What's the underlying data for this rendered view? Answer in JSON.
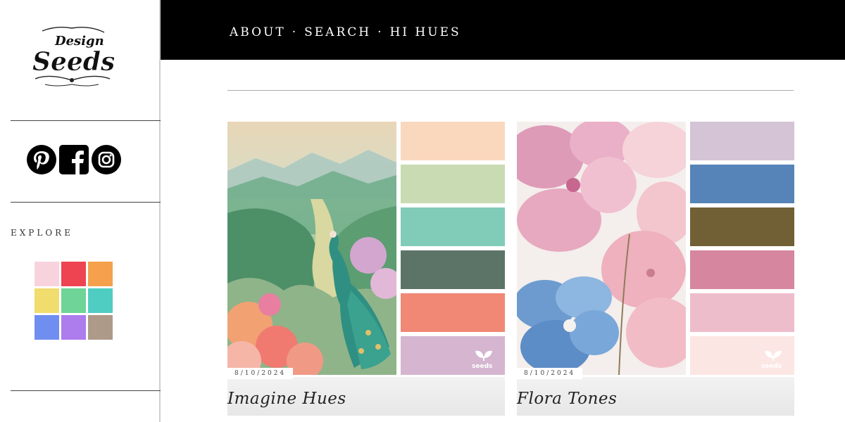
{
  "sidebar": {
    "logo_alt": "Design Seeds",
    "explore_label": "EXPLORE",
    "social": [
      "pinterest-icon",
      "facebook-icon",
      "instagram-icon"
    ],
    "explore_colors": [
      "#f8d3de",
      "#ee4452",
      "#f4a04c",
      "#f1dc6e",
      "#6fd497",
      "#4fcdc2",
      "#6f8ef0",
      "#ad7ced",
      "#ae9a89"
    ]
  },
  "nav": {
    "items": [
      "ABOUT",
      "SEARCH",
      "HI HUES"
    ],
    "separator": "·"
  },
  "cards": [
    {
      "date": "8/10/2024",
      "title": "Imagine Hues",
      "palette": [
        "#fad8be",
        "#c9dbb3",
        "#81cbb9",
        "#5c7468",
        "#f08875",
        "#d5b5d0"
      ]
    },
    {
      "date": "8/10/2024",
      "title": "Flora Tones",
      "palette": [
        "#d4c4d5",
        "#5684b8",
        "#716035",
        "#d6869f",
        "#eebdcb",
        "#fce6e4"
      ]
    }
  ]
}
